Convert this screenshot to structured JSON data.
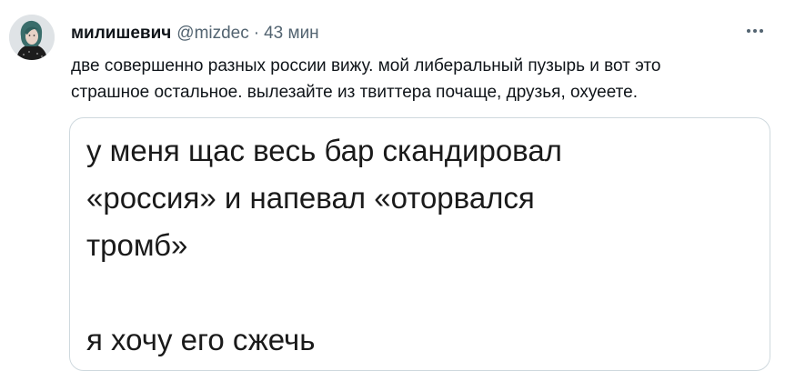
{
  "tweet": {
    "author": {
      "display_name": "милишевич",
      "handle": "@mizdec",
      "separator": "·",
      "time": "43 мин",
      "avatar_icon": "avatar-photo"
    },
    "more_icon": "more-horizontal-icon",
    "text_lines": [
      "две совершенно разных россии вижу. мой либеральный пузырь и вот это",
      "страшное остальное. вылезайте из твиттера почаще, друзья, охуеете."
    ],
    "media": {
      "lines": [
        "у меня щас весь бар скандировал",
        "«россия» и напевал «оторвался",
        "тромб»",
        "я хочу его сжечь"
      ]
    }
  },
  "colors": {
    "text": "#0f1419",
    "secondary": "#536471",
    "border": "#cfd9de"
  }
}
